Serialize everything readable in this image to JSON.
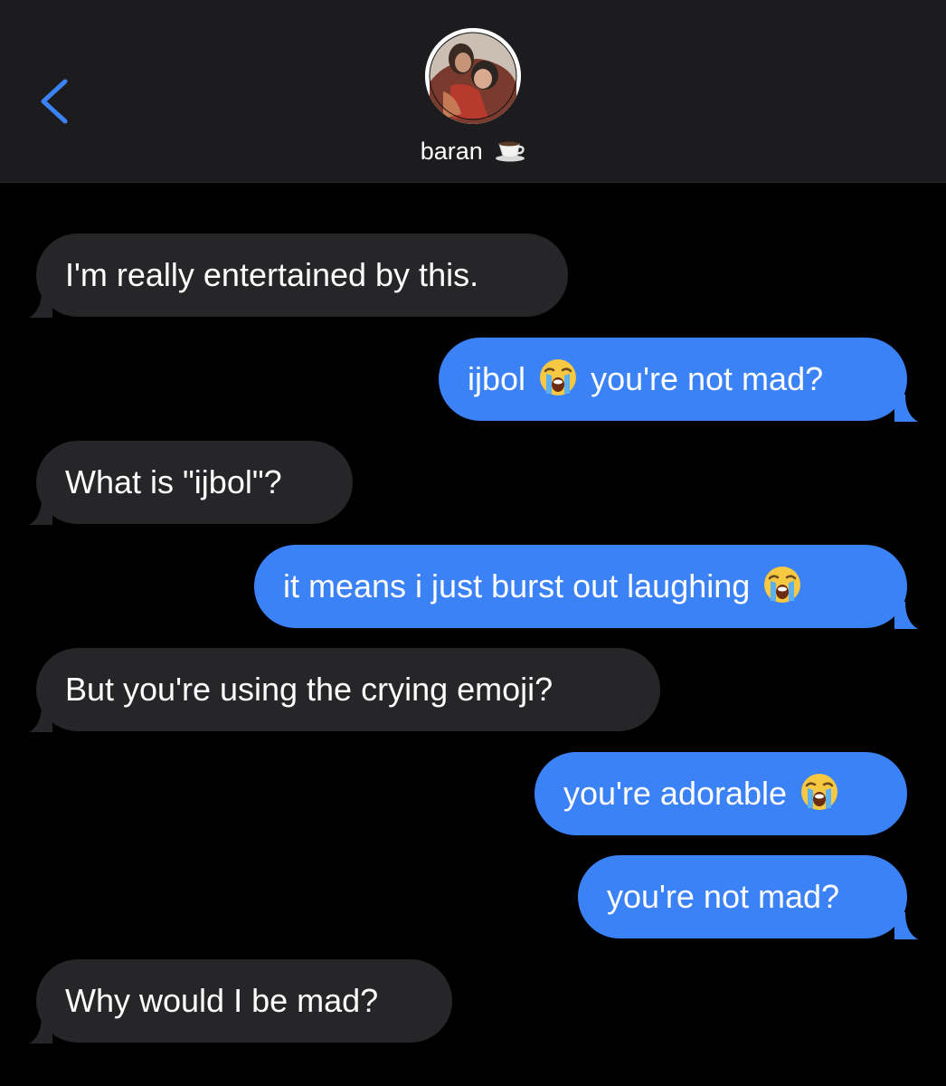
{
  "header": {
    "contact_name": "baran",
    "contact_emoji": "coffee-cup-icon",
    "back_icon": "chevron-left-icon",
    "accent_color": "#3b82f6"
  },
  "messages": [
    {
      "direction": "incoming",
      "parts": [
        "I'm really entertained by this."
      ]
    },
    {
      "direction": "outgoing",
      "parts": [
        "ijbol",
        "you're not mad?"
      ],
      "emoji": "loudly-crying-face-icon"
    },
    {
      "direction": "incoming",
      "parts": [
        "What is \"ijbol\"?"
      ]
    },
    {
      "direction": "outgoing",
      "parts": [
        "it means i just burst out laughing"
      ],
      "emoji": "loudly-crying-face-icon"
    },
    {
      "direction": "incoming",
      "parts": [
        "But you're using the crying emoji?"
      ]
    },
    {
      "direction": "outgoing",
      "parts": [
        "you're adorable"
      ],
      "emoji": "loudly-crying-face-icon"
    },
    {
      "direction": "outgoing",
      "parts": [
        "you're not mad?"
      ]
    },
    {
      "direction": "incoming",
      "parts": [
        "Why would I be mad?"
      ]
    }
  ],
  "colors": {
    "incoming_bubble": "#262628",
    "outgoing_bubble": "#3b82f6",
    "header_bg": "#1c1c1e"
  }
}
